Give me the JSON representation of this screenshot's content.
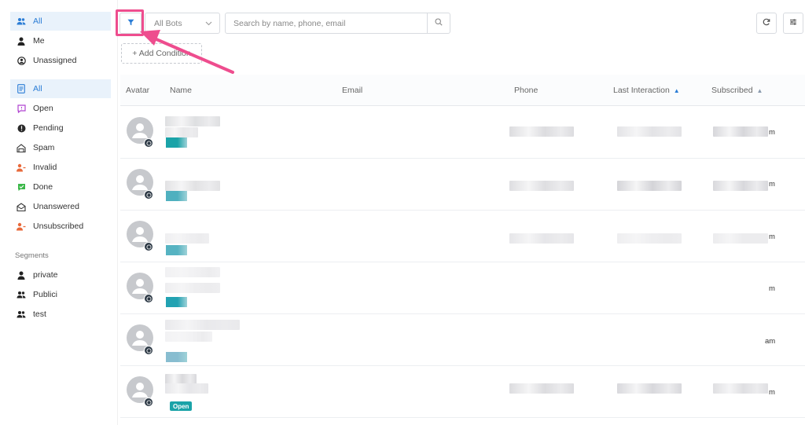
{
  "sidebar": {
    "top_items": [
      {
        "label": "All",
        "icon": "users-icon"
      },
      {
        "label": "Me",
        "icon": "user-icon"
      },
      {
        "label": "Unassigned",
        "icon": "user-circle-icon"
      }
    ],
    "status_items": [
      {
        "label": "All",
        "icon": "document-icon"
      },
      {
        "label": "Open",
        "icon": "chat-bubble-icon"
      },
      {
        "label": "Pending",
        "icon": "alert-icon"
      },
      {
        "label": "Spam",
        "icon": "spam-icon"
      },
      {
        "label": "Invalid",
        "icon": "user-invalid-icon"
      },
      {
        "label": "Done",
        "icon": "check-icon"
      },
      {
        "label": "Unanswered",
        "icon": "envelope-open-icon"
      },
      {
        "label": "Unsubscribed",
        "icon": "user-unsubscribe-icon"
      }
    ],
    "segments_label": "Segments",
    "segments": [
      {
        "label": "private",
        "icon": "user-icon"
      },
      {
        "label": "Publici",
        "icon": "users-icon"
      },
      {
        "label": "test",
        "icon": "users-icon"
      }
    ]
  },
  "toolbar": {
    "bots_select": "All Bots",
    "search_placeholder": "Search by name, phone, email",
    "add_condition": "+ Add Condition"
  },
  "table": {
    "columns": [
      "Avatar",
      "Name",
      "Email",
      "Phone",
      "Last Interaction",
      "Subscribed"
    ],
    "rows": [
      {
        "subscribed_suffix": "m",
        "status": ""
      },
      {
        "subscribed_suffix": "m",
        "status": ""
      },
      {
        "subscribed_suffix": "m",
        "status": ""
      },
      {
        "subscribed_suffix": "m",
        "status": ""
      },
      {
        "subscribed_suffix": "am",
        "status": ""
      },
      {
        "subscribed_suffix": "m",
        "status": "Open"
      }
    ]
  },
  "colors": {
    "accent": "#2b7dd6",
    "highlight": "#ee4d8e",
    "tag": "#1aa3a8"
  }
}
